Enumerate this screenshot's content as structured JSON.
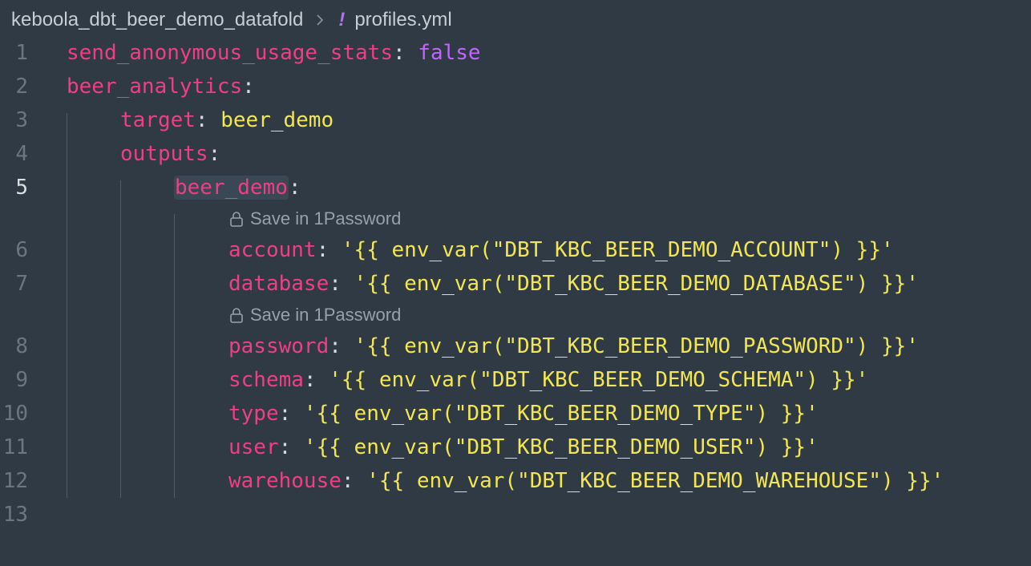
{
  "breadcrumb": {
    "folder": "keboola_dbt_beer_demo_datafold",
    "file_icon": "!",
    "file": "profiles.yml"
  },
  "codelens": {
    "label": "Save in 1Password"
  },
  "lines": [
    {
      "num": "1",
      "key": "send_anonymous_usage_stats",
      "colon": ":",
      "value": " false"
    },
    {
      "num": "2",
      "key": "beer_analytics",
      "colon": ":"
    },
    {
      "num": "3",
      "key": "target",
      "colon": ":",
      "value": " beer_demo"
    },
    {
      "num": "4",
      "key": "outputs",
      "colon": ":"
    },
    {
      "num": "5",
      "key": "beer_demo",
      "colon": ":"
    },
    {
      "num": "6",
      "key": "account",
      "colon": ":",
      "value": " '{{ env_var(\"DBT_KBC_BEER_DEMO_ACCOUNT\") }}'"
    },
    {
      "num": "7",
      "key": "database",
      "colon": ":",
      "value": " '{{ env_var(\"DBT_KBC_BEER_DEMO_DATABASE\") }}'"
    },
    {
      "num": "8",
      "key": "password",
      "colon": ":",
      "value": " '{{ env_var(\"DBT_KBC_BEER_DEMO_PASSWORD\") }}'"
    },
    {
      "num": "9",
      "key": "schema",
      "colon": ":",
      "value": " '{{ env_var(\"DBT_KBC_BEER_DEMO_SCHEMA\") }}'"
    },
    {
      "num": "10",
      "key": "type",
      "colon": ":",
      "value": " '{{ env_var(\"DBT_KBC_BEER_DEMO_TYPE\") }}'"
    },
    {
      "num": "11",
      "key": "user",
      "colon": ":",
      "value": " '{{ env_var(\"DBT_KBC_BEER_DEMO_USER\") }}'"
    },
    {
      "num": "12",
      "key": "warehouse",
      "colon": ":",
      "value": " '{{ env_var(\"DBT_KBC_BEER_DEMO_WAREHOUSE\") }}'"
    },
    {
      "num": "13"
    }
  ],
  "colors": {
    "background": "#2f3a45",
    "key": "#ee3f84",
    "boolean": "#c464ff",
    "string": "#f3e653",
    "line_number": "#6c7681"
  }
}
